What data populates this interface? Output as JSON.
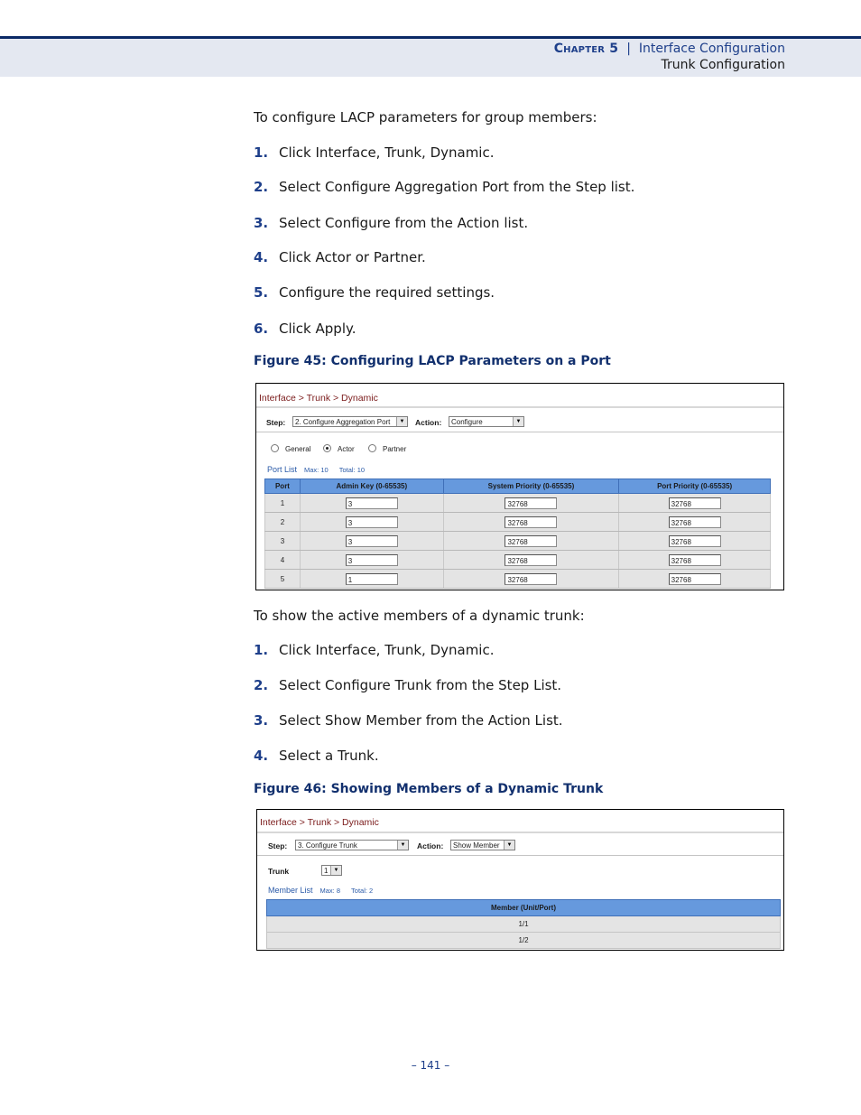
{
  "header": {
    "chapter_word": "Chapter",
    "chapter_num": "5",
    "separator": "|",
    "section": "Interface Configuration",
    "subsection": "Trunk Configuration"
  },
  "part1": {
    "intro": "To configure LACP parameters for group members:",
    "steps": [
      {
        "num": "1.",
        "text": "Click Interface, Trunk, Dynamic."
      },
      {
        "num": "2.",
        "text": "Select Configure Aggregation Port from the Step list."
      },
      {
        "num": "3.",
        "text": "Select Configure from the Action list."
      },
      {
        "num": "4.",
        "text": "Click Actor or Partner."
      },
      {
        "num": "5.",
        "text": "Configure the required settings."
      },
      {
        "num": "6.",
        "text": "Click Apply."
      }
    ],
    "figure_caption": "Figure 45:  Configuring LACP Parameters on a Port"
  },
  "figure45": {
    "breadcrumb": "Interface > Trunk > Dynamic",
    "step_label": "Step:",
    "step_value": "2. Configure Aggregation Port",
    "action_label": "Action:",
    "action_value": "Configure",
    "radios": [
      {
        "label": "General",
        "checked": false
      },
      {
        "label": "Actor",
        "checked": true
      },
      {
        "label": "Partner",
        "checked": false
      }
    ],
    "list_title": "Port List",
    "list_max": "Max: 10",
    "list_total": "Total: 10",
    "columns": [
      "Port",
      "Admin Key (0-65535)",
      "System Priority (0-65535)",
      "Port Priority (0-65535)"
    ],
    "rows": [
      {
        "port": "1",
        "admin_key": "3",
        "system_priority": "32768",
        "port_priority": "32768"
      },
      {
        "port": "2",
        "admin_key": "3",
        "system_priority": "32768",
        "port_priority": "32768"
      },
      {
        "port": "3",
        "admin_key": "3",
        "system_priority": "32768",
        "port_priority": "32768"
      },
      {
        "port": "4",
        "admin_key": "3",
        "system_priority": "32768",
        "port_priority": "32768"
      },
      {
        "port": "5",
        "admin_key": "1",
        "system_priority": "32768",
        "port_priority": "32768"
      }
    ]
  },
  "part2": {
    "intro": "To show the active members of a dynamic trunk:",
    "steps": [
      {
        "num": "1.",
        "text": "Click Interface, Trunk, Dynamic."
      },
      {
        "num": "2.",
        "text": "Select Configure Trunk from the Step List."
      },
      {
        "num": "3.",
        "text": "Select Show Member from the Action List."
      },
      {
        "num": "4.",
        "text": "Select a Trunk."
      }
    ],
    "figure_caption": "Figure 46:  Showing Members of a Dynamic Trunk"
  },
  "figure46": {
    "breadcrumb": "Interface > Trunk > Dynamic",
    "step_label": "Step:",
    "step_value": "3. Configure Trunk",
    "action_label": "Action:",
    "action_value": "Show Member",
    "trunk_label": "Trunk",
    "trunk_value": "1",
    "list_title": "Member List",
    "list_max": "Max: 8",
    "list_total": "Total: 2",
    "column": "Member (Unit/Port)",
    "rows": [
      "1/1",
      "1/2"
    ]
  },
  "footer": {
    "page_number": "–  141  –"
  }
}
